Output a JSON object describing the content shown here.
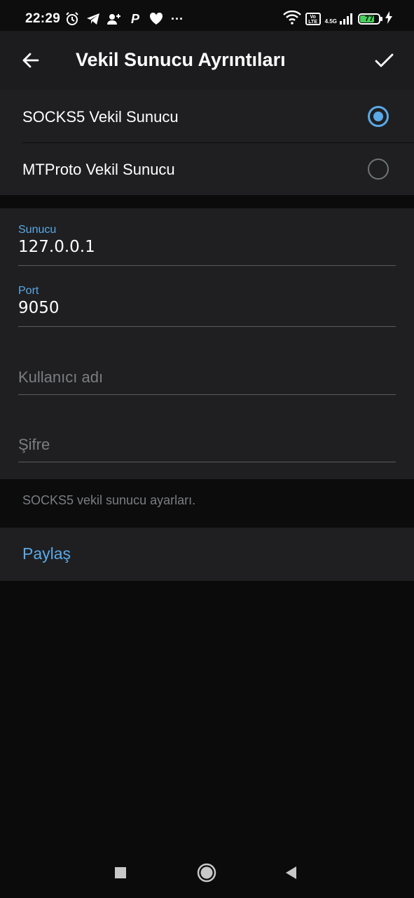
{
  "status_bar": {
    "time": "22:29",
    "network": "4.5G",
    "volte": "Vo LTE",
    "battery_text": "77",
    "battery_level": 0.77,
    "battery_color": "#48d05a",
    "left_icons": [
      "alarm-icon",
      "telegram-icon",
      "add-contact-icon",
      "p-app-icon",
      "heart-icon",
      "more-dots-icon"
    ],
    "more_dots": "···",
    "p_letter": "P"
  },
  "app_bar": {
    "title": "Vekil Sunucu Ayrıntıları",
    "back_icon": "back-arrow-icon",
    "done_icon": "checkmark-icon"
  },
  "proxy_types": [
    {
      "label": "SOCKS5 Vekil Sunucu",
      "selected": true
    },
    {
      "label": "MTProto Vekil Sunucu",
      "selected": false
    }
  ],
  "fields": {
    "server": {
      "label": "Sunucu",
      "value": "127.0.0.1"
    },
    "port": {
      "label": "Port",
      "value": "9050"
    },
    "username": {
      "placeholder": "Kullanıcı adı"
    },
    "password": {
      "placeholder": "Şifre"
    }
  },
  "info_text": "SOCKS5 vekil sunucu ayarları.",
  "share_label": "Paylaş",
  "colors": {
    "accent": "#5aa9e8",
    "surface": "#1f1f21",
    "background": "#0b0b0c"
  }
}
